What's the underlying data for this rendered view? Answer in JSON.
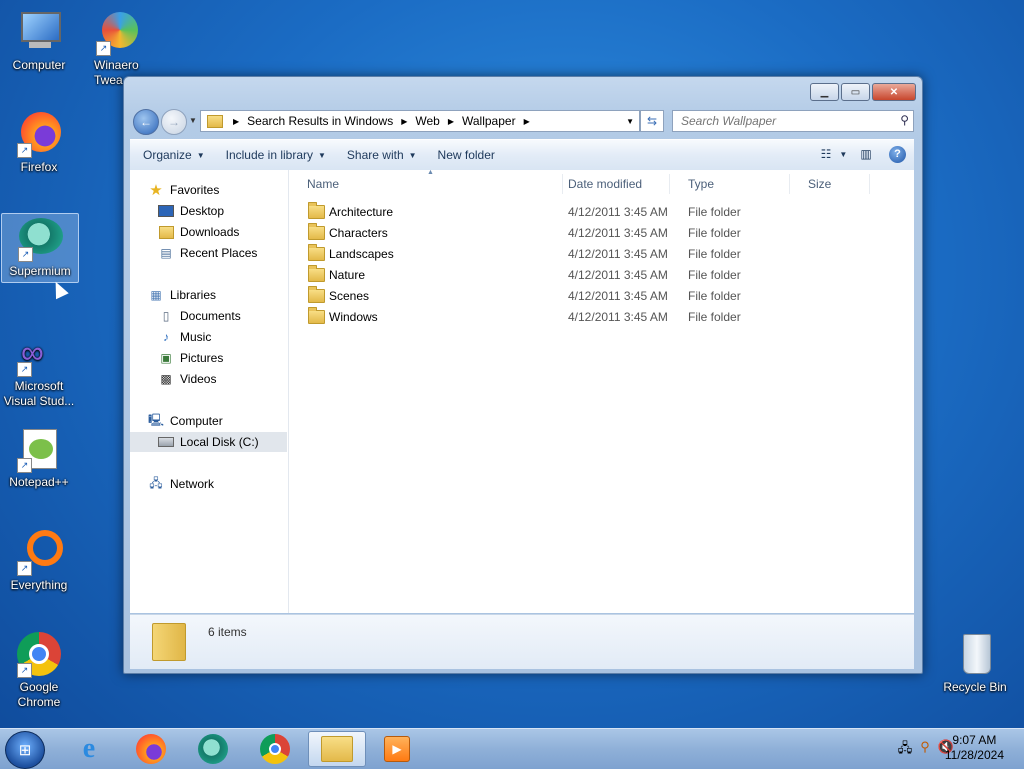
{
  "desktop": {
    "icons": [
      {
        "label": "Computer"
      },
      {
        "label": "Winaero Twea"
      },
      {
        "label": "Firefox"
      },
      {
        "label": "Supermium"
      },
      {
        "label": "Microsoft Visual Stud..."
      },
      {
        "label": "Notepad++"
      },
      {
        "label": "Everything"
      },
      {
        "label": "Google Chrome"
      },
      {
        "label": "Recycle Bin"
      }
    ]
  },
  "window": {
    "breadcrumb": [
      "Search Results in Windows",
      "Web",
      "Wallpaper"
    ],
    "search_placeholder": "Search Wallpaper",
    "toolbar": {
      "organize": "Organize",
      "include_in_library": "Include in library",
      "share_with": "Share with",
      "new_folder": "New folder"
    },
    "nav": {
      "favorites": "Favorites",
      "desktop": "Desktop",
      "downloads": "Downloads",
      "recent_places": "Recent Places",
      "libraries": "Libraries",
      "documents": "Documents",
      "music": "Music",
      "pictures": "Pictures",
      "videos": "Videos",
      "computer": "Computer",
      "local_disk": "Local Disk (C:)",
      "network": "Network"
    },
    "columns": {
      "name": "Name",
      "date": "Date modified",
      "type": "Type",
      "size": "Size"
    },
    "files": [
      {
        "name": "Architecture",
        "date": "4/12/2011 3:45 AM",
        "type": "File folder"
      },
      {
        "name": "Characters",
        "date": "4/12/2011 3:45 AM",
        "type": "File folder"
      },
      {
        "name": "Landscapes",
        "date": "4/12/2011 3:45 AM",
        "type": "File folder"
      },
      {
        "name": "Nature",
        "date": "4/12/2011 3:45 AM",
        "type": "File folder"
      },
      {
        "name": "Scenes",
        "date": "4/12/2011 3:45 AM",
        "type": "File folder"
      },
      {
        "name": "Windows",
        "date": "4/12/2011 3:45 AM",
        "type": "File folder"
      }
    ],
    "item_count": "6 items"
  },
  "taskbar": {
    "time": "9:07 AM",
    "date": "11/28/2024"
  }
}
